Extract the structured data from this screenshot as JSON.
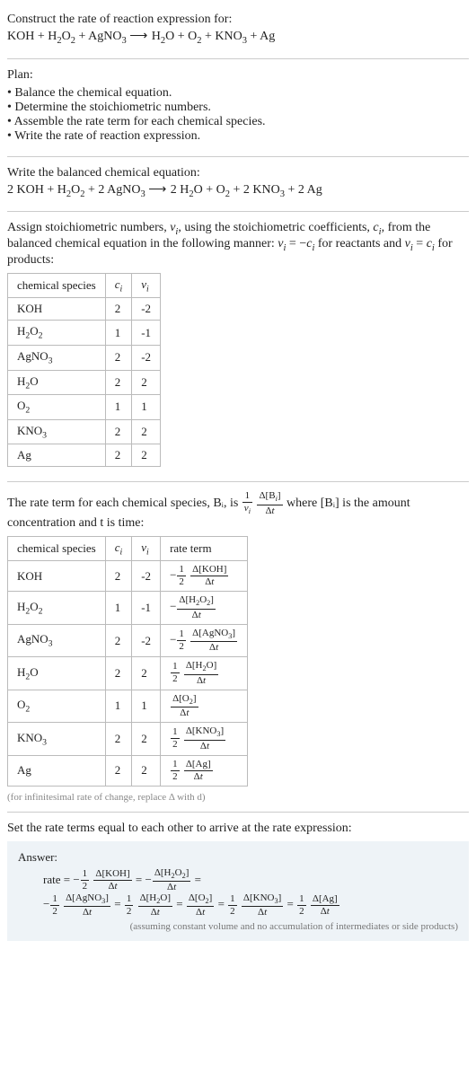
{
  "intro": {
    "construct": "Construct the rate of reaction expression for:",
    "equation_plain": "KOH + H2O2 + AgNO3 ⟶ H2O + O2 + KNO3 + Ag"
  },
  "plan": {
    "title": "Plan:",
    "items": [
      "Balance the chemical equation.",
      "Determine the stoichiometric numbers.",
      "Assemble the rate term for each chemical species.",
      "Write the rate of reaction expression."
    ]
  },
  "balanced": {
    "title": "Write the balanced chemical equation:",
    "equation_plain": "2 KOH + H2O2 + 2 AgNO3 ⟶ 2 H2O + O2 + 2 KNO3 + 2 Ag"
  },
  "assign_text": "Assign stoichiometric numbers, νᵢ, using the stoichiometric coefficients, cᵢ, from the balanced chemical equation in the following manner: νᵢ = −cᵢ for reactants and νᵢ = cᵢ for products:",
  "table1": {
    "headers": [
      "chemical species",
      "cᵢ",
      "νᵢ"
    ],
    "rows": [
      {
        "species": "KOH",
        "c": "2",
        "v": "-2"
      },
      {
        "species": "H2O2",
        "c": "1",
        "v": "-1"
      },
      {
        "species": "AgNO3",
        "c": "2",
        "v": "-2"
      },
      {
        "species": "H2O",
        "c": "2",
        "v": "2"
      },
      {
        "species": "O2",
        "c": "1",
        "v": "1"
      },
      {
        "species": "KNO3",
        "c": "2",
        "v": "2"
      },
      {
        "species": "Ag",
        "c": "2",
        "v": "2"
      }
    ]
  },
  "rate_term_text_a": "The rate term for each chemical species, Bᵢ, is ",
  "rate_term_text_b": " where [Bᵢ] is the amount concentration and t is time:",
  "table2": {
    "headers": [
      "chemical species",
      "cᵢ",
      "νᵢ",
      "rate term"
    ],
    "rows": [
      {
        "species": "KOH",
        "c": "2",
        "v": "-2",
        "coef_num": "1",
        "coef_den": "2",
        "neg": true,
        "conc": "Δ[KOH]"
      },
      {
        "species": "H2O2",
        "c": "1",
        "v": "-1",
        "coef_num": "",
        "coef_den": "",
        "neg": true,
        "conc": "Δ[H2O2]"
      },
      {
        "species": "AgNO3",
        "c": "2",
        "v": "-2",
        "coef_num": "1",
        "coef_den": "2",
        "neg": true,
        "conc": "Δ[AgNO3]"
      },
      {
        "species": "H2O",
        "c": "2",
        "v": "2",
        "coef_num": "1",
        "coef_den": "2",
        "neg": false,
        "conc": "Δ[H2O]"
      },
      {
        "species": "O2",
        "c": "1",
        "v": "1",
        "coef_num": "",
        "coef_den": "",
        "neg": false,
        "conc": "Δ[O2]"
      },
      {
        "species": "KNO3",
        "c": "2",
        "v": "2",
        "coef_num": "1",
        "coef_den": "2",
        "neg": false,
        "conc": "Δ[KNO3]"
      },
      {
        "species": "Ag",
        "c": "2",
        "v": "2",
        "coef_num": "1",
        "coef_den": "2",
        "neg": false,
        "conc": "Δ[Ag]"
      }
    ]
  },
  "infinitesimal_note": "(for infinitesimal rate of change, replace Δ with d)",
  "set_equal_text": "Set the rate terms equal to each other to arrive at the rate expression:",
  "answer": {
    "label": "Answer:",
    "note": "(assuming constant volume and no accumulation of intermediates or side products)"
  },
  "chart_data": {
    "type": "table",
    "title": "Stoichiometric numbers and rate terms",
    "series": [
      {
        "name": "stoichiometric_numbers",
        "columns": [
          "species",
          "c_i",
          "nu_i"
        ],
        "rows": [
          [
            "KOH",
            2,
            -2
          ],
          [
            "H2O2",
            1,
            -1
          ],
          [
            "AgNO3",
            2,
            -2
          ],
          [
            "H2O",
            2,
            2
          ],
          [
            "O2",
            1,
            1
          ],
          [
            "KNO3",
            2,
            2
          ],
          [
            "Ag",
            2,
            2
          ]
        ]
      },
      {
        "name": "rate_terms",
        "columns": [
          "species",
          "c_i",
          "nu_i",
          "rate_term"
        ],
        "rows": [
          [
            "KOH",
            2,
            -2,
            "-(1/2) Δ[KOH]/Δt"
          ],
          [
            "H2O2",
            1,
            -1,
            "-Δ[H2O2]/Δt"
          ],
          [
            "AgNO3",
            2,
            -2,
            "-(1/2) Δ[AgNO3]/Δt"
          ],
          [
            "H2O",
            2,
            2,
            "(1/2) Δ[H2O]/Δt"
          ],
          [
            "O2",
            1,
            1,
            "Δ[O2]/Δt"
          ],
          [
            "KNO3",
            2,
            2,
            "(1/2) Δ[KNO3]/Δt"
          ],
          [
            "Ag",
            2,
            2,
            "(1/2) Δ[Ag]/Δt"
          ]
        ]
      }
    ],
    "rate_expression": "rate = -(1/2) Δ[KOH]/Δt = -Δ[H2O2]/Δt = -(1/2) Δ[AgNO3]/Δt = (1/2) Δ[H2O]/Δt = Δ[O2]/Δt = (1/2) Δ[KNO3]/Δt = (1/2) Δ[Ag]/Δt"
  }
}
